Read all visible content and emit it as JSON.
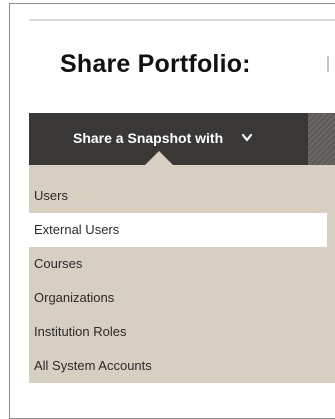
{
  "page": {
    "title": "Share Portfolio:"
  },
  "toolbar": {
    "share_label": "Share a Snapshot with",
    "chevron_icon": "chevron-down-icon"
  },
  "menu": {
    "items": [
      {
        "label": "Users",
        "highlighted": false
      },
      {
        "label": "External Users",
        "highlighted": true
      },
      {
        "label": "Courses",
        "highlighted": false
      },
      {
        "label": "Organizations",
        "highlighted": false
      },
      {
        "label": "Institution Roles",
        "highlighted": false
      },
      {
        "label": "All System Accounts",
        "highlighted": false
      }
    ]
  },
  "colors": {
    "toolbar_bg": "#3a3836",
    "menu_bg": "#d6cfc2",
    "highlight_bg": "#ffffff",
    "text": "#2b2b2b"
  }
}
